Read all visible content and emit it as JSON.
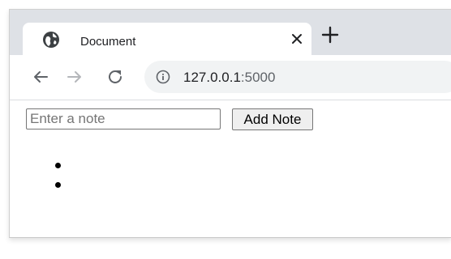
{
  "browser": {
    "tab": {
      "title": "Document"
    },
    "address_bar": {
      "host": "127.0.0.1",
      "port": ":5000"
    }
  },
  "page": {
    "note_input": {
      "placeholder": "Enter a note",
      "value": ""
    },
    "add_button": {
      "label": "Add Note"
    },
    "notes": [
      "",
      ""
    ]
  },
  "icons": {
    "favicon": "globe-icon",
    "tab_close": "close-icon",
    "new_tab": "plus-icon",
    "back": "arrow-left-icon",
    "forward": "arrow-right-icon",
    "reload": "reload-icon",
    "site_info": "info-icon"
  }
}
